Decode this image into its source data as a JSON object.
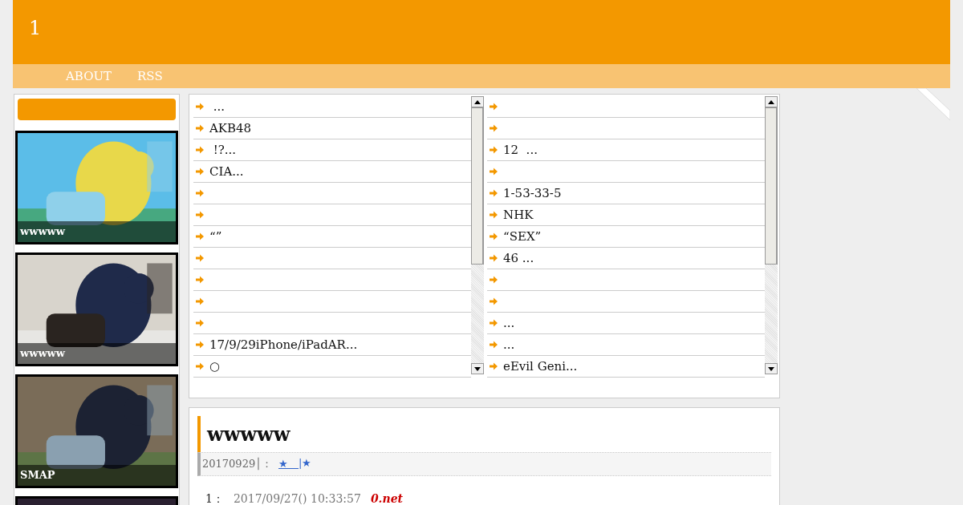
{
  "header": {
    "title": "1"
  },
  "nav": [
    "ABOUT",
    "RSS"
  ],
  "sidebar": {
    "cards": [
      {
        "kind": "picture",
        "caption": "wwwww"
      },
      {
        "kind": "picture",
        "caption": "wwwww"
      },
      {
        "kind": "picture",
        "caption": "SMAP"
      },
      {
        "kind": "picture"
      }
    ]
  },
  "link_lists": [
    {
      "items": [
        {
          "kind": "link",
          "text": " ..."
        },
        {
          "kind": "link",
          "text": "AKB48"
        },
        {
          "kind": "link",
          "text": " !?..."
        },
        {
          "kind": "link",
          "text": "CIA..."
        },
        {
          "kind": "blank"
        },
        {
          "kind": "blank"
        },
        {
          "kind": "link",
          "text": "“”"
        },
        {
          "kind": "blank"
        },
        {
          "kind": "blank"
        },
        {
          "kind": "blank"
        },
        {
          "kind": "blank"
        },
        {
          "kind": "link",
          "text": "17/9/29iPhone/iPadAR..."
        },
        {
          "kind": "link",
          "text": "○"
        }
      ]
    },
    {
      "items": [
        {
          "kind": "blank"
        },
        {
          "kind": "blank"
        },
        {
          "kind": "link",
          "text": "12  ..."
        },
        {
          "kind": "blank"
        },
        {
          "kind": "link",
          "text": "1-53-33-5"
        },
        {
          "kind": "link",
          "text": "NHK"
        },
        {
          "kind": "link",
          "text": "“SEX”"
        },
        {
          "kind": "link",
          "text": "46 ..."
        },
        {
          "kind": "blank"
        },
        {
          "kind": "blank"
        },
        {
          "kind": "link",
          "text": "..."
        },
        {
          "kind": "link",
          "text": "..."
        },
        {
          "kind": "link",
          "text": "eEvil Geni..."
        }
      ]
    }
  ],
  "article": {
    "title": "wwwww",
    "date": "20170929│：",
    "tag_link": "★＿",
    "tag_after": "|★",
    "comment": {
      "number": "1：",
      "time": "2017/09/27() 10:33:57",
      "name": "0.net"
    }
  }
}
